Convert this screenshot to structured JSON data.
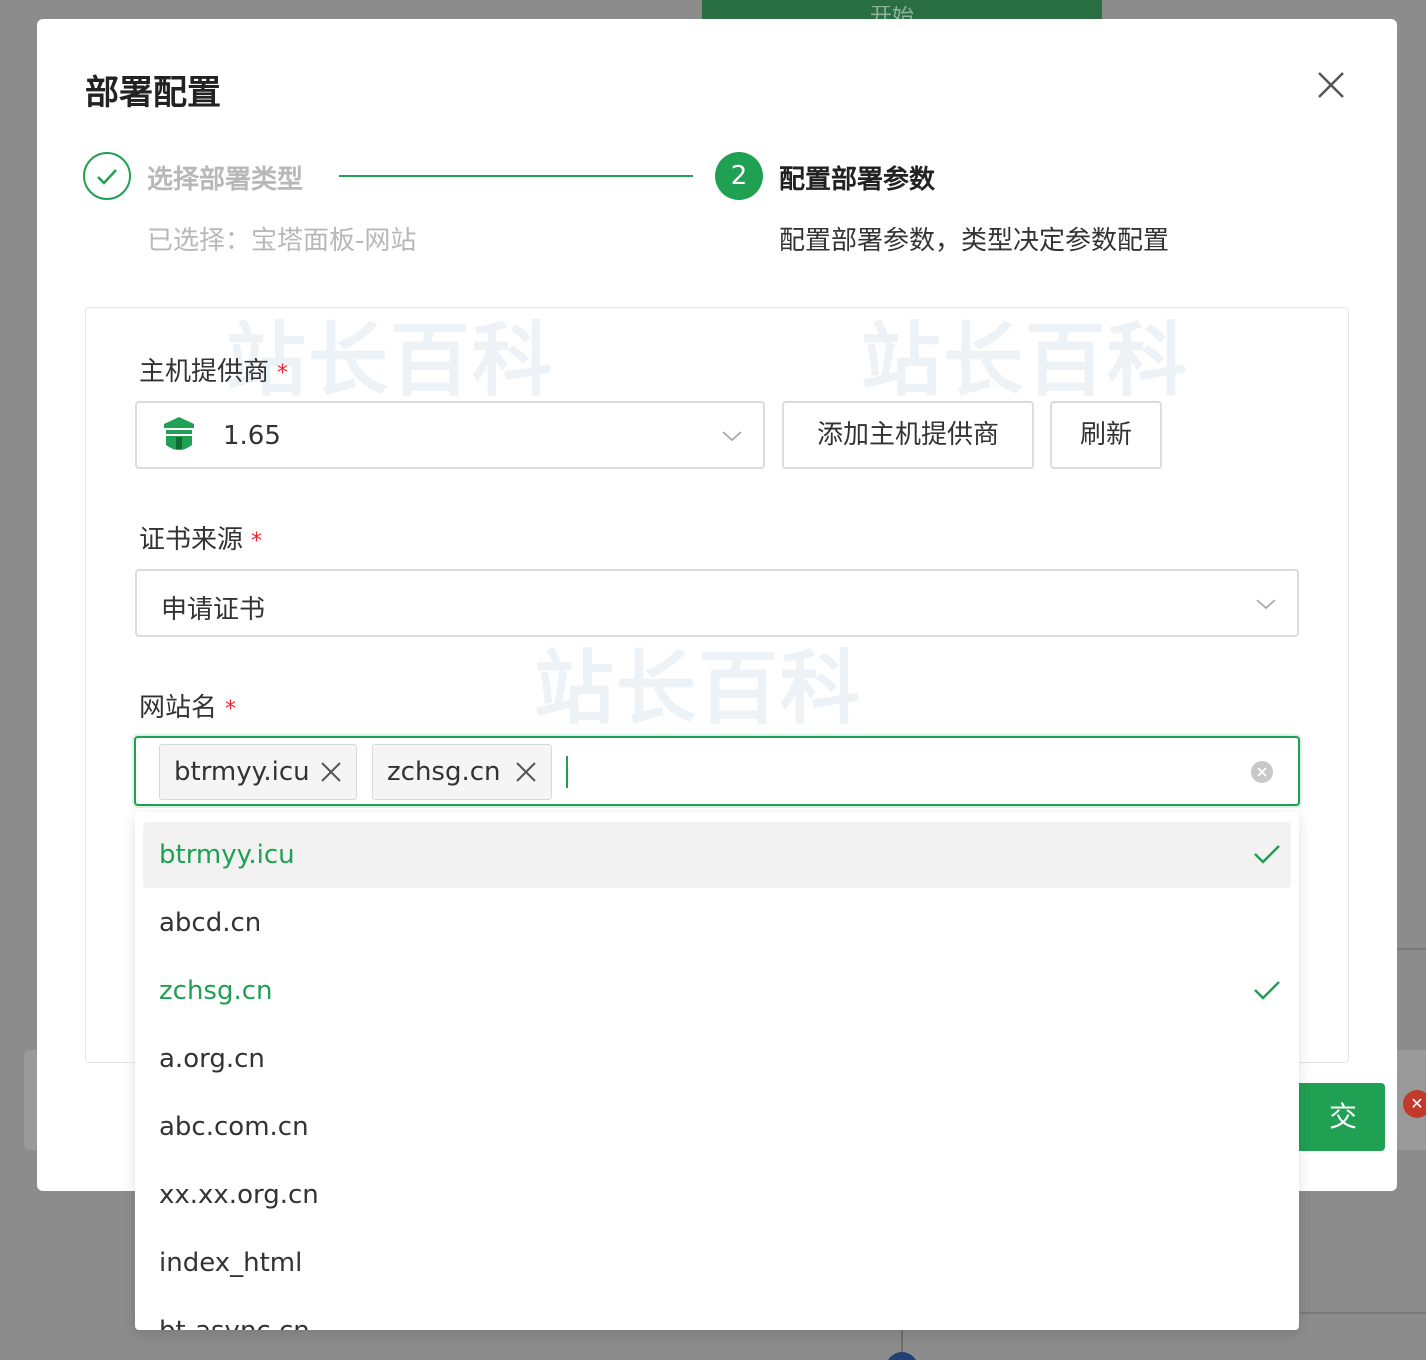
{
  "background": {
    "top_button_label": "开始",
    "badge_icon": "close-icon"
  },
  "modal": {
    "title": "部署配置",
    "steps": [
      {
        "title": "选择部署类型",
        "desc": "已选择：宝塔面板-网站",
        "state": "done",
        "icon": "check-icon"
      },
      {
        "title": "配置部署参数",
        "desc": "配置部署参数，类型决定参数配置",
        "state": "active",
        "number": "2"
      }
    ],
    "watermark_text": "站长百科",
    "accent_color": "#20a053",
    "form": {
      "host_provider": {
        "label": "主机提供商",
        "required_mark": "*",
        "value": "1.65",
        "icon": "bt-panel-logo-icon",
        "add_button": "添加主机提供商",
        "refresh_button": "刷新"
      },
      "cert_source": {
        "label": "证书来源",
        "required_mark": "*",
        "value": "申请证书"
      },
      "site_name": {
        "label": "网站名",
        "required_mark": "*",
        "tags": [
          "btrmyy.icu",
          "zchsg.cn"
        ]
      }
    },
    "submit_button_partial": "交"
  },
  "dropdown": {
    "options": [
      {
        "label": "btrmyy.icu",
        "selected": true,
        "hovered": true
      },
      {
        "label": "abcd.cn",
        "selected": false
      },
      {
        "label": "zchsg.cn",
        "selected": true
      },
      {
        "label": "a.org.cn",
        "selected": false
      },
      {
        "label": "abc.com.cn",
        "selected": false
      },
      {
        "label": "xx.xx.org.cn",
        "selected": false
      },
      {
        "label": "index_html",
        "selected": false
      },
      {
        "label": "bt-async.cn",
        "selected": false
      }
    ]
  }
}
